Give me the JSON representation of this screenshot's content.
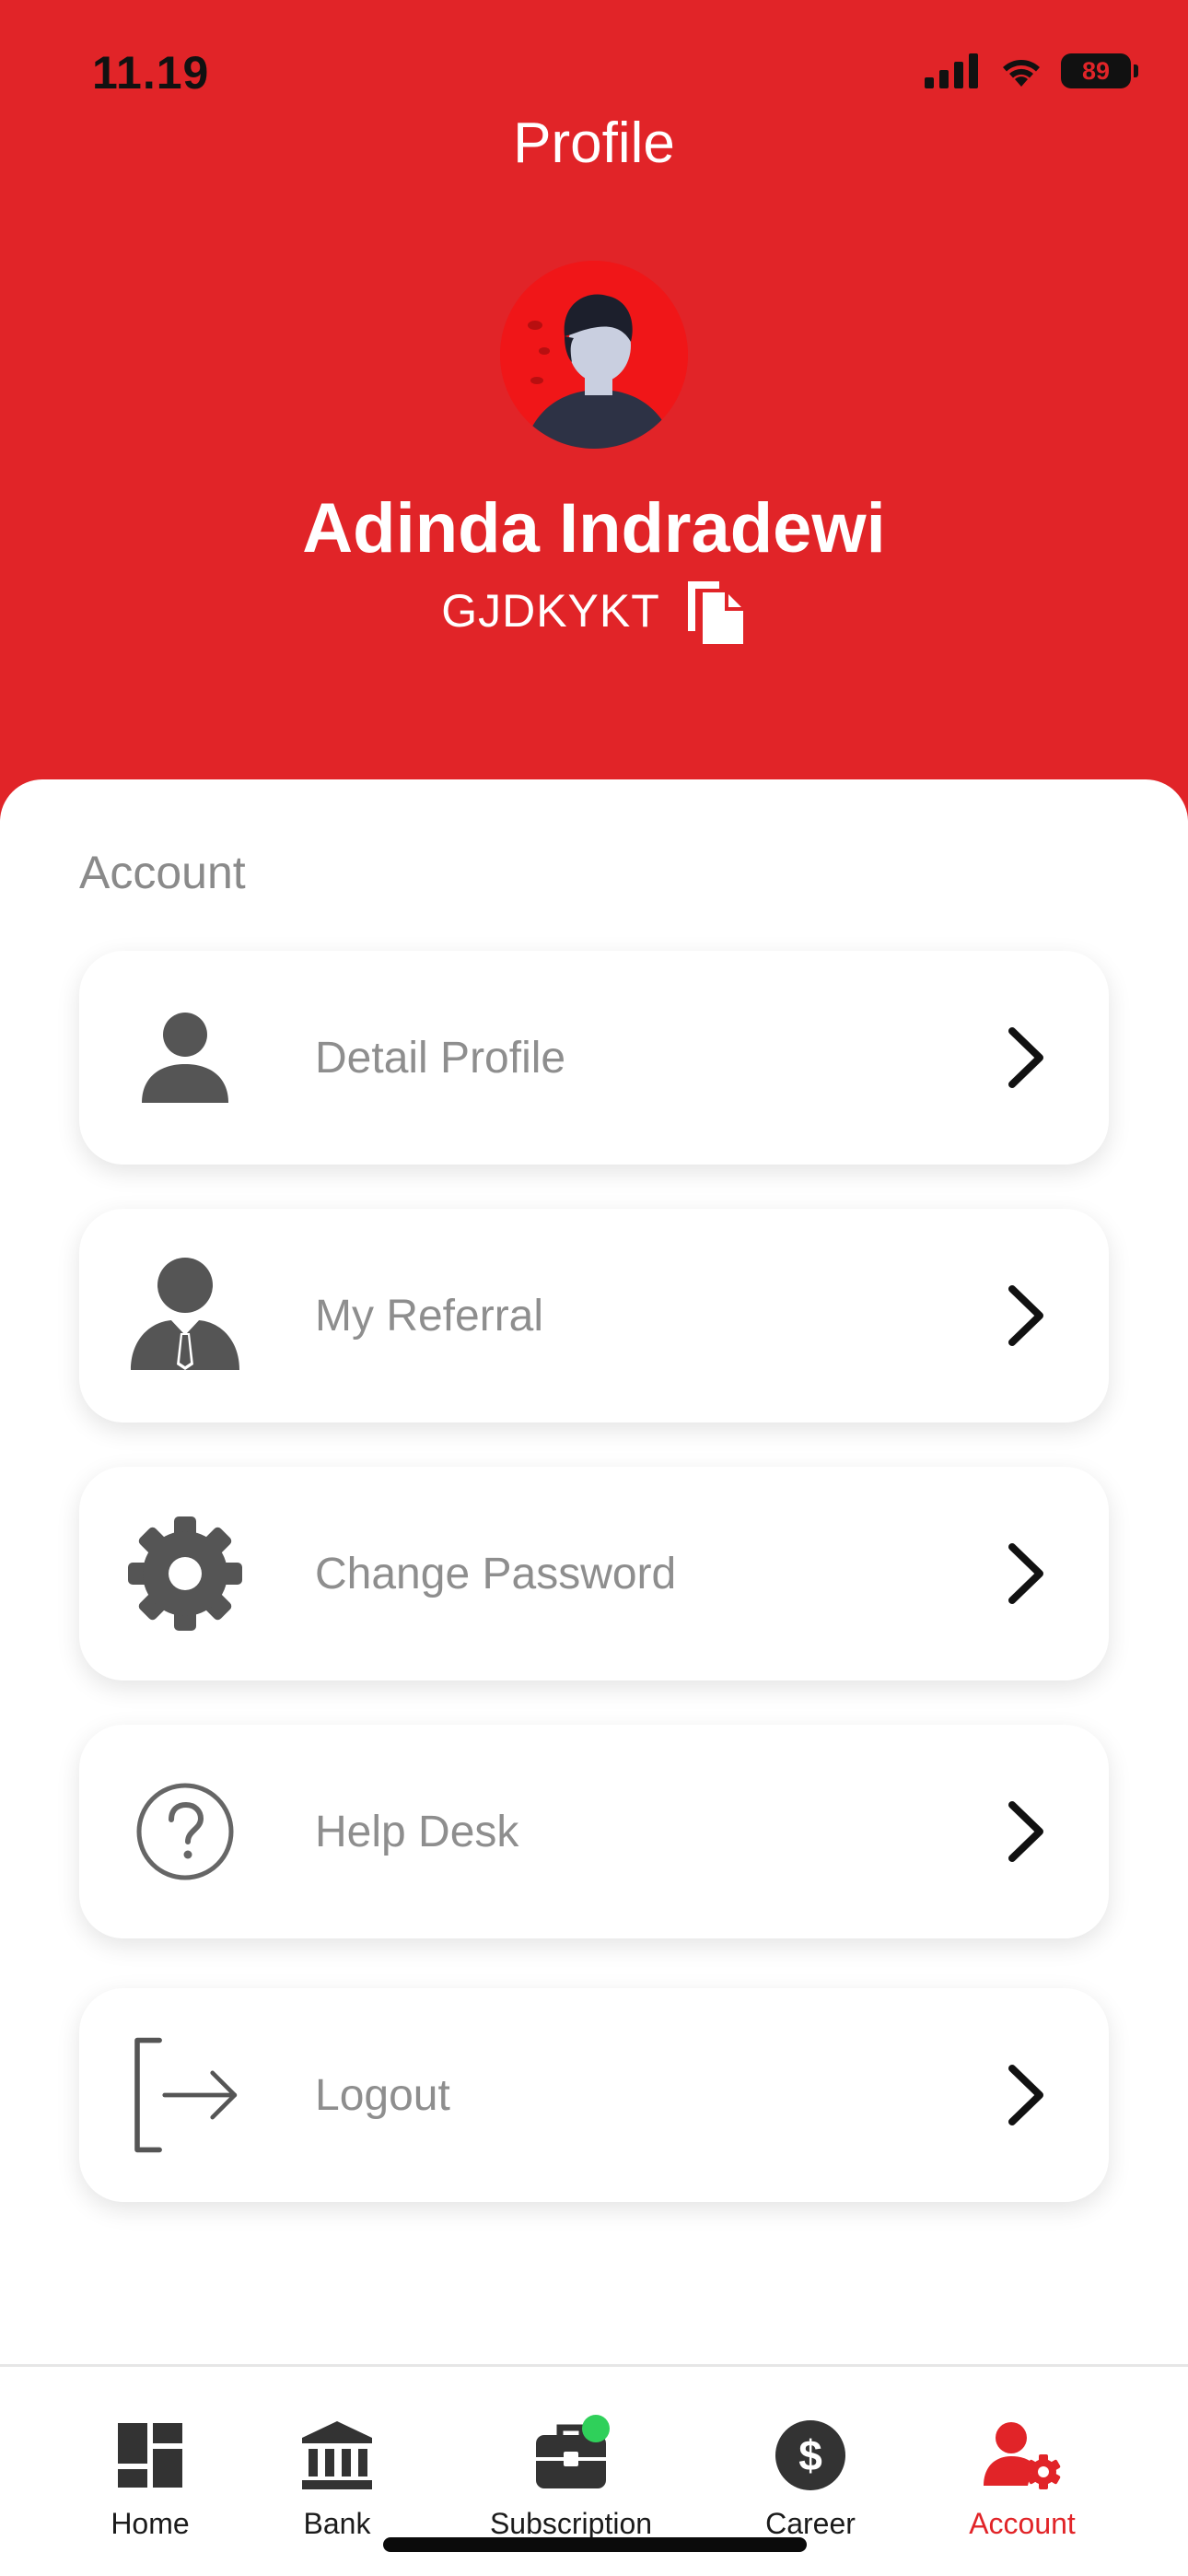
{
  "status_bar": {
    "time": "11.19",
    "battery": "89"
  },
  "header": {
    "title": "Profile"
  },
  "profile": {
    "name": "Adinda Indradewi",
    "code": "GJDKYKT"
  },
  "section": {
    "label": "Account"
  },
  "menu": [
    {
      "label": "Detail Profile",
      "icon": "person-icon"
    },
    {
      "label": "My Referral",
      "icon": "businessman-icon"
    },
    {
      "label": "Change Password",
      "icon": "gear-icon"
    },
    {
      "label": "Help Desk",
      "icon": "help-circle-icon"
    },
    {
      "label": "Logout",
      "icon": "logout-icon"
    }
  ],
  "tabs": [
    {
      "label": "Home",
      "icon": "dashboard-grid-icon"
    },
    {
      "label": "Bank",
      "icon": "bank-icon"
    },
    {
      "label": "Subscription",
      "icon": "briefcase-icon",
      "badge": "online-dot"
    },
    {
      "label": "Career",
      "icon": "dollar-coin-icon"
    },
    {
      "label": "Account",
      "icon": "user-settings-icon",
      "active": true
    }
  ],
  "colors": {
    "brand_red": "#e12428",
    "text_gray": "#8e8e8e",
    "icon_gray": "#555555",
    "badge_green": "#2fd05a"
  }
}
